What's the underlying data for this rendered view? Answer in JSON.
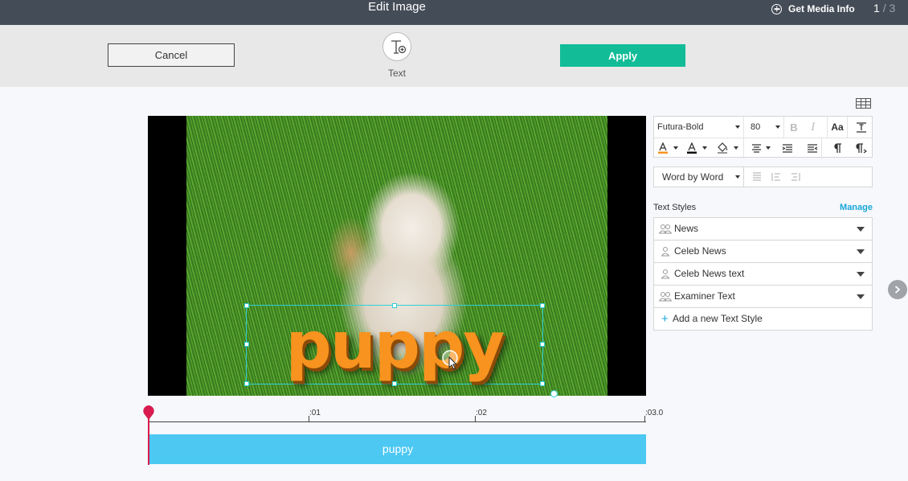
{
  "header": {
    "title": "Edit Image",
    "media_info_label": "Get Media Info",
    "page_current": "1",
    "page_total": "/ 3"
  },
  "toolbar": {
    "cancel_label": "Cancel",
    "apply_label": "Apply",
    "text_tool_label": "Text"
  },
  "canvas": {
    "overlay_text": "puppy",
    "overlay_color": "#f7931e",
    "selection_color": "#2fd0d8"
  },
  "format_panel": {
    "font_family": "Futura-Bold",
    "font_size": "80",
    "bold_glyph": "B",
    "italic_glyph": "I",
    "case_glyph": "Aa",
    "animation_mode": "Word by Word",
    "text_color_swatch": "#f7931e"
  },
  "text_styles": {
    "heading": "Text Styles",
    "manage_label": "Manage",
    "items": [
      {
        "label": "News",
        "icon": "group-icon"
      },
      {
        "label": "Celeb News",
        "icon": "person-icon"
      },
      {
        "label": "Celeb News text",
        "icon": "person-icon"
      },
      {
        "label": "Examiner Text",
        "icon": "group-icon"
      }
    ],
    "add_label": "Add a new Text Style"
  },
  "timeline": {
    "ticks": [
      ":01",
      ":02",
      ":03.0"
    ],
    "clip_label": "puppy",
    "clip_color": "#4cc8f3",
    "playhead_color": "#d81b4f"
  }
}
